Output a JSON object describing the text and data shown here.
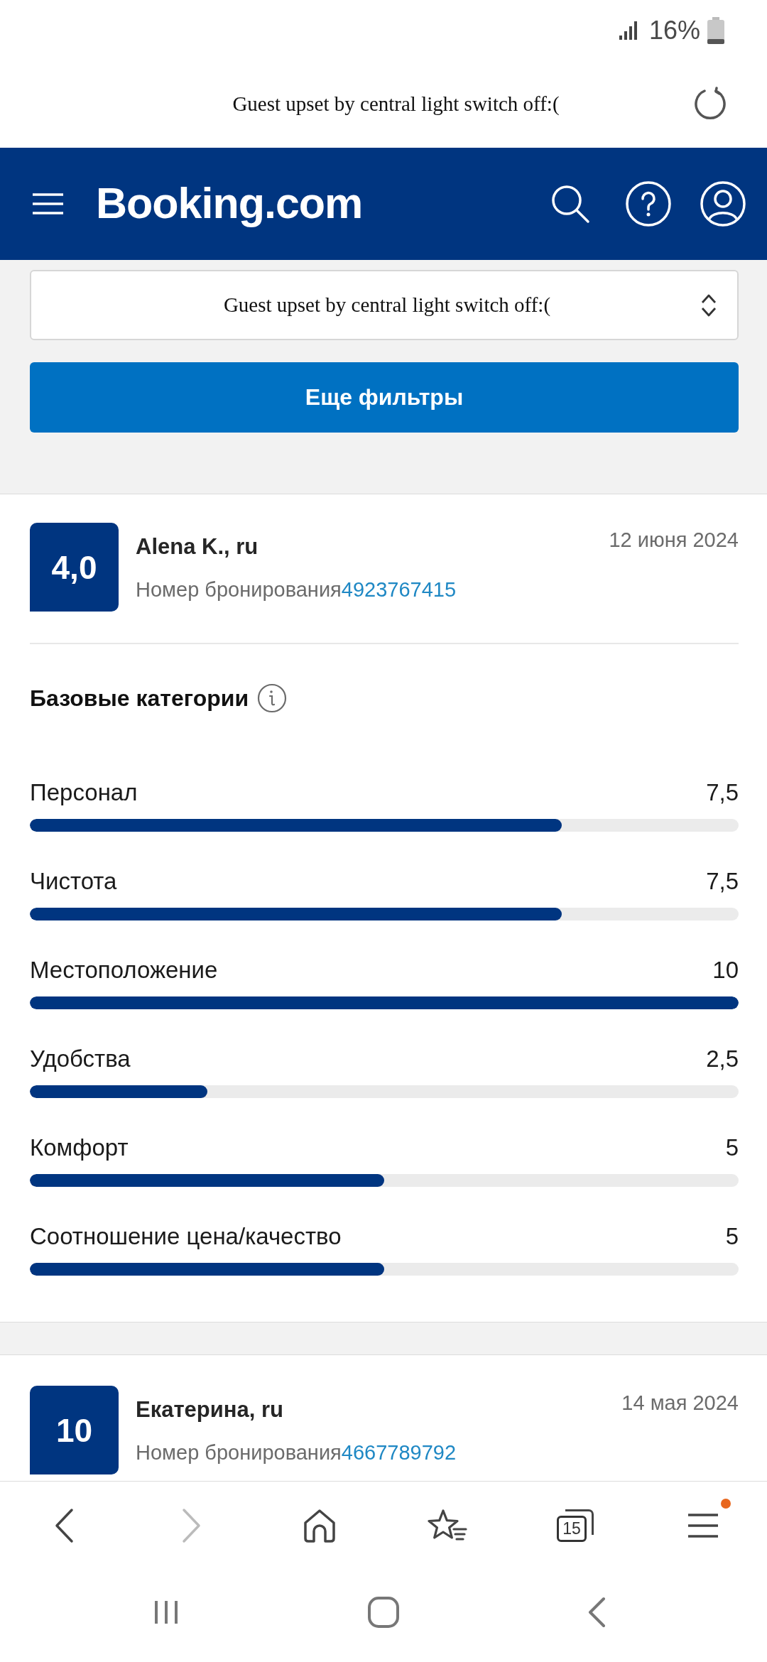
{
  "status_bar": {
    "battery": "16%"
  },
  "address_bar": {
    "caption": "Guest upset by central light switch off:("
  },
  "header": {
    "logo": "Booking.com"
  },
  "filters": {
    "sort_dropdown": {
      "value": "Guest upset by central light switch off:("
    },
    "more_button": "Еще фильтры"
  },
  "reviews": [
    {
      "score": "4,0",
      "author": "Alena K., ru",
      "date": "12 июня 2024",
      "booking_label": "Номер бронирования",
      "booking_number": "4923767415",
      "categories_title": "Базовые категории",
      "categories": [
        {
          "name": "Персонал",
          "value": "7,5",
          "level": 0.75
        },
        {
          "name": "Чистота",
          "value": "7,5",
          "level": 0.75
        },
        {
          "name": "Местоположение",
          "value": "10",
          "level": 1
        },
        {
          "name": "Удобства",
          "value": "2,5",
          "level": 0.25
        },
        {
          "name": "Комфорт",
          "value": "5",
          "level": 0.5
        },
        {
          "name": "Соотношение цена/качество",
          "value": "5",
          "level": 0.5
        }
      ]
    },
    {
      "score": "10",
      "author": "Екатерина, ru",
      "date": "14 мая 2024",
      "booking_label": "Номер бронирования",
      "booking_number": "4667789792"
    }
  ],
  "browser_toolbar": {
    "items": [
      {
        "kind": "back",
        "disabled": false,
        "badge": false
      },
      {
        "kind": "forward",
        "disabled": true,
        "badge": false
      },
      {
        "kind": "home",
        "disabled": false,
        "badge": false
      },
      {
        "kind": "bookmarks",
        "disabled": false,
        "badge": false
      },
      {
        "kind": "tabs",
        "disabled": false,
        "badge": false,
        "count": "15"
      },
      {
        "kind": "menu",
        "disabled": false,
        "badge": true
      }
    ]
  }
}
